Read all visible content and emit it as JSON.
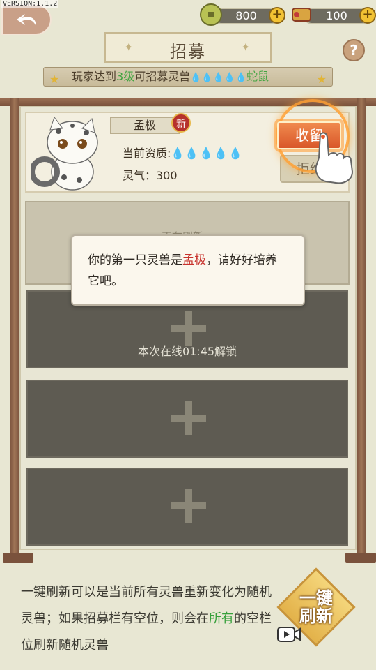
{
  "version": "VERSION:1.1.2",
  "resources": {
    "coins": "800",
    "tickets": "100",
    "plus": "+"
  },
  "header": {
    "title": "招募",
    "help": "?"
  },
  "banner": {
    "prefix": "玩家达到",
    "level": "3级",
    "suffix": "可招募灵兽",
    "quality_icons": "💧💧💧💧💧",
    "target": "蛇鼠"
  },
  "card": {
    "name": "孟极",
    "new_badge": "新",
    "quality_label": "当前资质:",
    "quality_gold": "💧",
    "quality_drops": "💧💧💧💧",
    "lingqi": "灵气：300",
    "keep_button": "收留",
    "reject_button": "拒绝"
  },
  "slot1": {
    "hint": "正在刷新..."
  },
  "dialog": {
    "line_prefix": "你的第一只灵兽是",
    "pet_name": "孟极",
    "line_suffix": "，请好好培养它吧。"
  },
  "slots": {
    "unlock_text": "本次在线01:45解锁"
  },
  "footer": {
    "tip_part1": "一键刷新可以是当前所有灵兽重新变化为随机灵兽；如果招募栏有空位，则会在",
    "tip_green": "所有",
    "tip_part2": "的空栏位刷新随机灵兽",
    "refresh_line1": "一键",
    "refresh_line2": "刷新"
  }
}
